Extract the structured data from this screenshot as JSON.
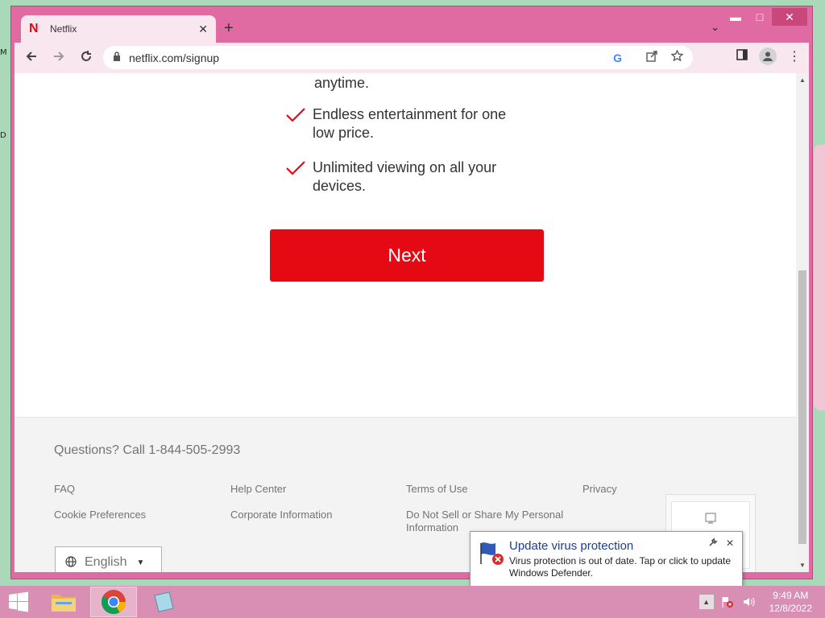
{
  "window": {
    "minimize": "▬",
    "maximize": "□",
    "close": "✕"
  },
  "tab": {
    "favicon": "N",
    "title": "Netflix",
    "close": "✕"
  },
  "toolbar": {
    "url": "netflix.com/signup",
    "icons": [
      "back-arrow-icon",
      "forward-arrow-icon",
      "reload-icon",
      "lock-icon",
      "google-icon",
      "share-icon",
      "star-icon",
      "sidepanel-icon",
      "profile-icon",
      "menu-icon"
    ]
  },
  "page": {
    "partial_text": "anytime.",
    "benefits": [
      "Endless entertainment for one low price.",
      "Unlimited viewing on all your devices."
    ],
    "next_button": "Next",
    "accent": "#e50914"
  },
  "footer": {
    "questions": "Questions? Call 1-844-505-2993",
    "links": [
      "FAQ",
      "Help Center",
      "Terms of Use",
      "Privacy",
      "Cookie Preferences",
      "Corporate Information",
      "Do Not Sell or Share My Personal Information"
    ],
    "language": "English"
  },
  "notification": {
    "title": "Update virus protection",
    "message": "Virus protection is out of date. Tap or click to update Windows Defender."
  },
  "taskbar": {
    "time": "9:49 AM",
    "date": "12/8/2022"
  }
}
